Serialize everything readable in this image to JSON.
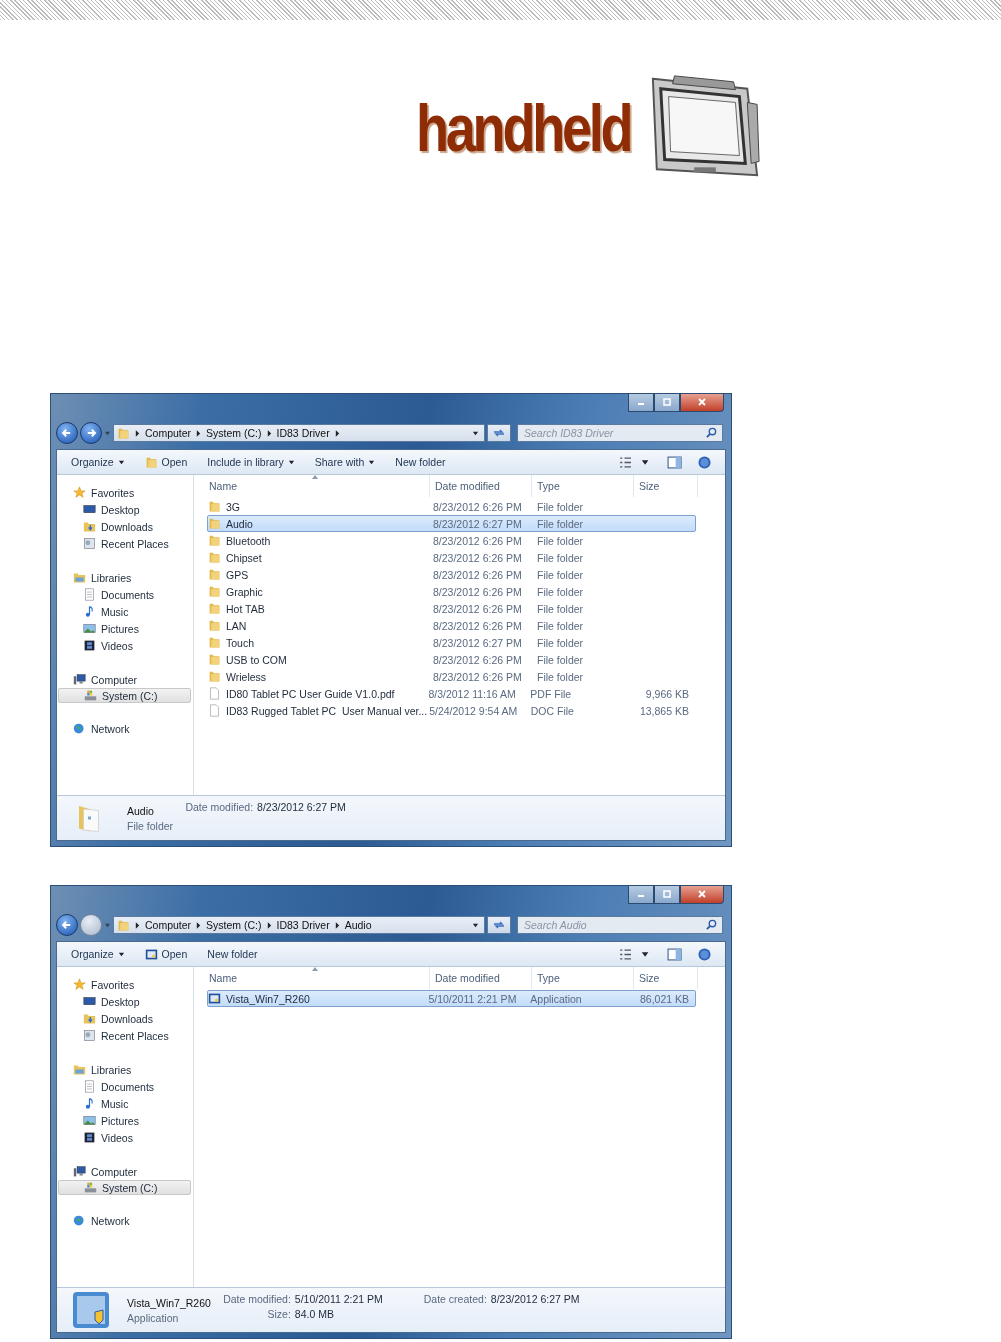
{
  "logo": {
    "text": "handheld"
  },
  "windows": [
    {
      "forward_enabled": true,
      "breadcrumb": [
        "Computer",
        "System (C:)",
        "ID83 Driver"
      ],
      "search": {
        "placeholder": "Search ID83 Driver"
      },
      "toolbar": [
        {
          "label": "Organize",
          "dropdown": true,
          "kind": "text"
        },
        {
          "label": "Open",
          "dropdown": false,
          "kind": "folder"
        },
        {
          "label": "Include in library",
          "dropdown": true,
          "kind": "text"
        },
        {
          "label": "Share with",
          "dropdown": true,
          "kind": "text"
        },
        {
          "label": "New folder",
          "dropdown": false,
          "kind": "text"
        }
      ],
      "nav": [
        {
          "label": "Favorites",
          "kind": "star",
          "selected": false,
          "children": [
            {
              "label": "Desktop",
              "kind": "desktop",
              "selected": false
            },
            {
              "label": "Downloads",
              "kind": "downloads",
              "selected": false
            },
            {
              "label": "Recent Places",
              "kind": "recent",
              "selected": false
            }
          ]
        },
        {
          "label": "Libraries",
          "kind": "library",
          "selected": false,
          "children": [
            {
              "label": "Documents",
              "kind": "document",
              "selected": false
            },
            {
              "label": "Music",
              "kind": "music",
              "selected": false
            },
            {
              "label": "Pictures",
              "kind": "pictures",
              "selected": false
            },
            {
              "label": "Videos",
              "kind": "videos",
              "selected": false
            }
          ]
        },
        {
          "label": "Computer",
          "kind": "computer",
          "selected": false,
          "children": [
            {
              "label": "System (C:)",
              "kind": "drive",
              "selected": true
            }
          ]
        },
        {
          "label": "Network",
          "kind": "network",
          "selected": false
        }
      ],
      "columns": [
        "Name",
        "Date modified",
        "Type",
        "Size"
      ],
      "rows": [
        {
          "kind": "folder",
          "name": "3G",
          "date": "8/23/2012 6:26 PM",
          "type": "File folder",
          "selected": false
        },
        {
          "kind": "folder",
          "name": "Audio",
          "date": "8/23/2012 6:27 PM",
          "type": "File folder",
          "selected": true
        },
        {
          "kind": "folder",
          "name": "Bluetooth",
          "date": "8/23/2012 6:26 PM",
          "type": "File folder",
          "selected": false
        },
        {
          "kind": "folder",
          "name": "Chipset",
          "date": "8/23/2012 6:26 PM",
          "type": "File folder",
          "selected": false
        },
        {
          "kind": "folder",
          "name": "GPS",
          "date": "8/23/2012 6:26 PM",
          "type": "File folder",
          "selected": false
        },
        {
          "kind": "folder",
          "name": "Graphic",
          "date": "8/23/2012 6:26 PM",
          "type": "File folder",
          "selected": false
        },
        {
          "kind": "folder",
          "name": "Hot TAB",
          "date": "8/23/2012 6:26 PM",
          "type": "File folder",
          "selected": false
        },
        {
          "kind": "folder",
          "name": "LAN",
          "date": "8/23/2012 6:26 PM",
          "type": "File folder",
          "selected": false
        },
        {
          "kind": "folder",
          "name": "Touch",
          "date": "8/23/2012 6:27 PM",
          "type": "File folder",
          "selected": false
        },
        {
          "kind": "folder",
          "name": "USB to COM",
          "date": "8/23/2012 6:26 PM",
          "type": "File folder",
          "selected": false
        },
        {
          "kind": "folder",
          "name": "Wrieless",
          "date": "8/23/2012 6:26 PM",
          "type": "File folder",
          "selected": false
        },
        {
          "kind": "file",
          "name": "ID80 Tablet PC User Guide V1.0.pdf",
          "date": "8/3/2012 11:16 AM",
          "type": "PDF File",
          "size": "9,966 KB",
          "selected": false
        },
        {
          "kind": "file",
          "name": "ID83 Rugged Tablet PC  User Manual ver...",
          "date": "5/24/2012 9:54 AM",
          "type": "DOC File",
          "size": "13,865 KB",
          "selected": false
        }
      ],
      "details": {
        "kind": "folder",
        "name": "Audio",
        "type": "File folder",
        "fields": [
          {
            "label": "Date modified:",
            "value": "8/23/2012 6:27 PM"
          }
        ]
      }
    },
    {
      "forward_enabled": false,
      "breadcrumb": [
        "Computer",
        "System (C:)",
        "ID83 Driver",
        "Audio"
      ],
      "search": {
        "placeholder": "Search Audio"
      },
      "toolbar": [
        {
          "label": "Organize",
          "dropdown": true,
          "kind": "text"
        },
        {
          "label": "Open",
          "dropdown": false,
          "kind": "application"
        },
        {
          "label": "New folder",
          "dropdown": false,
          "kind": "text"
        }
      ],
      "nav": [
        {
          "label": "Favorites",
          "kind": "star",
          "selected": false,
          "children": [
            {
              "label": "Desktop",
              "kind": "desktop",
              "selected": false
            },
            {
              "label": "Downloads",
              "kind": "downloads",
              "selected": false
            },
            {
              "label": "Recent Places",
              "kind": "recent",
              "selected": false
            }
          ]
        },
        {
          "label": "Libraries",
          "kind": "library",
          "selected": false,
          "children": [
            {
              "label": "Documents",
              "kind": "document",
              "selected": false
            },
            {
              "label": "Music",
              "kind": "music",
              "selected": false
            },
            {
              "label": "Pictures",
              "kind": "pictures",
              "selected": false
            },
            {
              "label": "Videos",
              "kind": "videos",
              "selected": false
            }
          ]
        },
        {
          "label": "Computer",
          "kind": "computer",
          "selected": false,
          "children": [
            {
              "label": "System (C:)",
              "kind": "drive",
              "selected": true
            }
          ]
        },
        {
          "label": "Network",
          "kind": "network",
          "selected": false
        }
      ],
      "columns": [
        "Name",
        "Date modified",
        "Type",
        "Size"
      ],
      "rows": [
        {
          "kind": "application",
          "name": "Vista_Win7_R260",
          "date": "5/10/2011 2:21 PM",
          "type": "Application",
          "size": "86,021 KB",
          "selected": true
        }
      ],
      "details": {
        "kind": "application",
        "name": "Vista_Win7_R260",
        "type": "Application",
        "fields": [
          {
            "label": "Date modified:",
            "value": "5/10/2011 2:21 PM"
          },
          {
            "label": "Size:",
            "value": "84.0 MB"
          },
          {
            "label": "Date created:",
            "value": "8/23/2012 6:27 PM"
          }
        ]
      }
    }
  ]
}
